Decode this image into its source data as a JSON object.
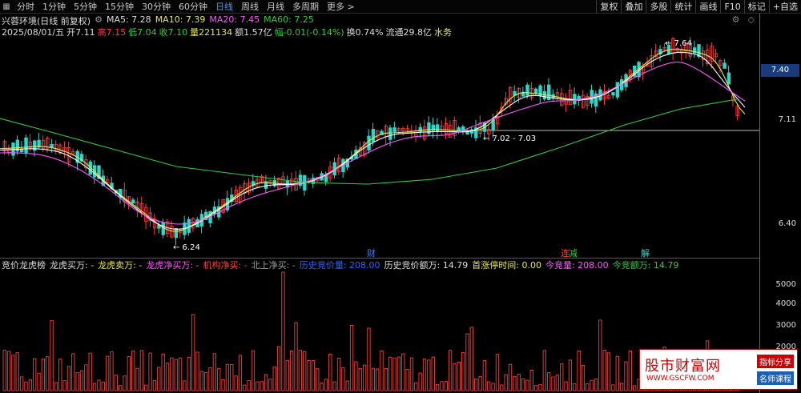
{
  "periods": [
    "分时",
    "1分钟",
    "5分钟",
    "15分钟",
    "30分钟",
    "60分钟",
    "日线",
    "周线",
    "月线",
    "多周期",
    "更多 >"
  ],
  "active_period": 6,
  "toolbar_right": [
    "复权",
    "叠加",
    "多股",
    "统计",
    "画线",
    "F10",
    "标记",
    "+自选"
  ],
  "ma_info": {
    "name": "兴蓉环境(日线 前复权)",
    "ma5": "MA5: 7.28",
    "ma10": "MA10: 7.39",
    "ma20": "MA20: 7.45",
    "ma60": "MA60: 7.25"
  },
  "ohlc": {
    "date": "2025/08/01/五",
    "open": "开7.11",
    "high": "高7.15",
    "low": "低7.04",
    "close": "收7.10",
    "volume": "量221134",
    "amount": "额1.57亿",
    "change": "幅-0.01(-0.14%)",
    "turnover": "换0.74%",
    "float_cap": "流通29.8亿",
    "sector": "水务"
  },
  "axis_labels": [
    "7.40",
    "7.11",
    "6.40"
  ],
  "vol_axis_labels": [
    "5000",
    "4000",
    "3000",
    "2000"
  ],
  "current_price_box": "7.40",
  "annotations": {
    "high_mark": "7.64",
    "low_mark": "6.24",
    "range_mark": "7.02 - 7.03",
    "marker_cai": "财",
    "marker_jian": "减",
    "marker_jie": "解",
    "marker_lian": "连"
  },
  "sub_indicator": {
    "name": "竞价龙虎榜",
    "items": [
      {
        "label": "龙虎买万: -",
        "color": "#dddddd"
      },
      {
        "label": "龙虎卖万: -",
        "color": "#e8e84a"
      },
      {
        "label": "龙虎净买万: -",
        "color": "#ff55ff"
      },
      {
        "label": "机构净买: -",
        "color": "#ff4040"
      },
      {
        "label": "北上净买: -",
        "color": "#9a9a9a"
      },
      {
        "label": "历史竞价量: 208.00",
        "color": "#2f62ff"
      },
      {
        "label": "历史竞价额万: 14.79",
        "color": "#dddddd"
      },
      {
        "label": "首涨停时间: 0.00",
        "color": "#e8e84a"
      },
      {
        "label": "今竞量: 208.00",
        "color": "#ff55ff"
      },
      {
        "label": "今竞额万: 14.79",
        "color": "#2ecc40"
      }
    ]
  },
  "watermark": {
    "title": "股市财富网",
    "url": "WWW.GSCFW.COM",
    "tag1": "指标分享",
    "tag2": "名师课程"
  },
  "colors": {
    "up": "#ff3b3b",
    "down": "#2fd5c8",
    "ma5": "#e8e84a",
    "ma10": "#ffffff",
    "ma20": "#ff55ff",
    "ma60": "#2ecc40"
  }
}
